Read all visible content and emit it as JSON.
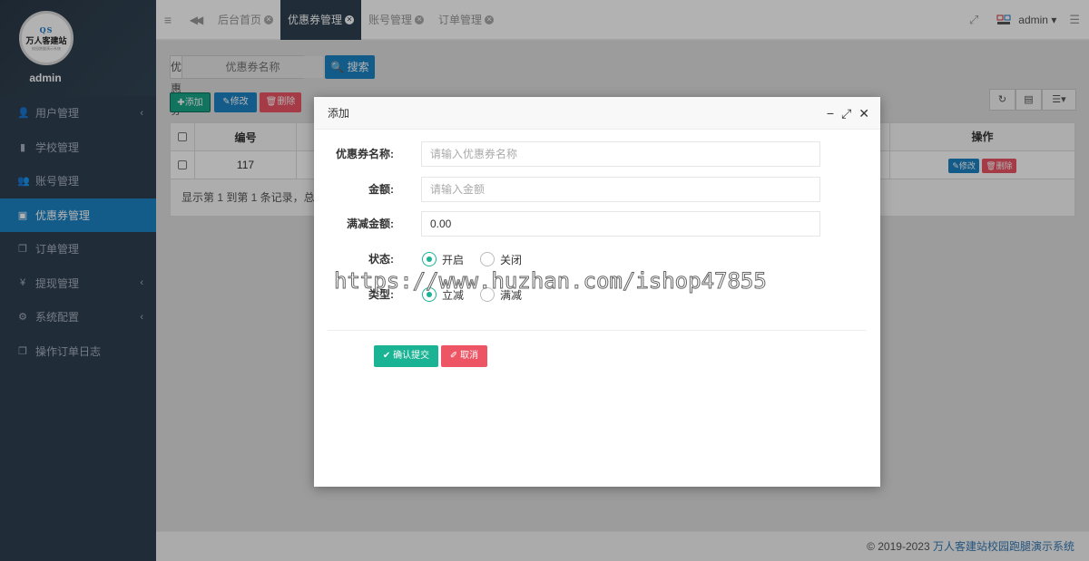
{
  "sidebar": {
    "username": "admin",
    "logo": {
      "mark": "QS",
      "text": "万人客建站",
      "sub": "校园跑腿演示系统"
    },
    "items": [
      {
        "label": "用户管理",
        "icon": "user-icon",
        "glyph": "👤",
        "chevron": "‹"
      },
      {
        "label": "学校管理",
        "icon": "book-icon",
        "glyph": "▮",
        "chevron": ""
      },
      {
        "label": "账号管理",
        "icon": "users-icon",
        "glyph": "👥",
        "chevron": ""
      },
      {
        "label": "优惠券管理",
        "icon": "money-icon",
        "glyph": "▣",
        "chevron": ""
      },
      {
        "label": "订单管理",
        "icon": "copy-icon",
        "glyph": "❐",
        "chevron": ""
      },
      {
        "label": "提现管理",
        "icon": "yen-icon",
        "glyph": "¥",
        "chevron": "‹"
      },
      {
        "label": "系统配置",
        "icon": "gear-icon",
        "glyph": "⚙",
        "chevron": "‹"
      },
      {
        "label": "操作订单日志",
        "icon": "copy-icon",
        "glyph": "❐",
        "chevron": ""
      }
    ]
  },
  "topbar": {
    "menu_glyph": "≡",
    "back_glyph": "◀◀",
    "tabs": [
      {
        "label": "后台首页"
      },
      {
        "label": "优惠券管理"
      },
      {
        "label": "账号管理"
      },
      {
        "label": "订单管理"
      }
    ],
    "close_glyph": "✕",
    "user": "admin",
    "caret": "▾",
    "fullscreen_glyph": "⤢",
    "list_glyph": "☰"
  },
  "search": {
    "label": "优惠券名称",
    "placeholder": "优惠券名称",
    "button": "搜索"
  },
  "toolbar": {
    "add": "添加",
    "edit": "修改",
    "delete": "删除"
  },
  "table": {
    "headers": {
      "id": "编号",
      "action": "操作"
    },
    "rows": [
      {
        "id": "117"
      }
    ],
    "row_edit": "修改",
    "row_delete": "删除",
    "footer": "显示第 1 到第 1 条记录，总共"
  },
  "footer": {
    "copyright": "© 2019-2023",
    "link": "万人客建站校园跑腿演示系统"
  },
  "modal": {
    "title": "添加",
    "fields": {
      "name": {
        "label": "优惠券名称:",
        "placeholder": "请输入优惠券名称"
      },
      "amount": {
        "label": "金额:",
        "placeholder": "请输入金额"
      },
      "threshold": {
        "label": "满减金额:",
        "value": "0.00"
      }
    },
    "status": {
      "label": "状态:",
      "options": [
        "开启",
        "关闭"
      ],
      "selected": "开启"
    },
    "type": {
      "label": "类型:",
      "options": [
        "立减",
        "满减"
      ],
      "selected": "立减"
    },
    "submit": "确认提交",
    "cancel": "取消"
  },
  "watermark": "https://www.huzhan.com/ishop47855",
  "colors": {
    "accent": "#1c84c6",
    "success": "#18a689",
    "danger": "#ed5565",
    "sidebar": "#2f4050"
  }
}
